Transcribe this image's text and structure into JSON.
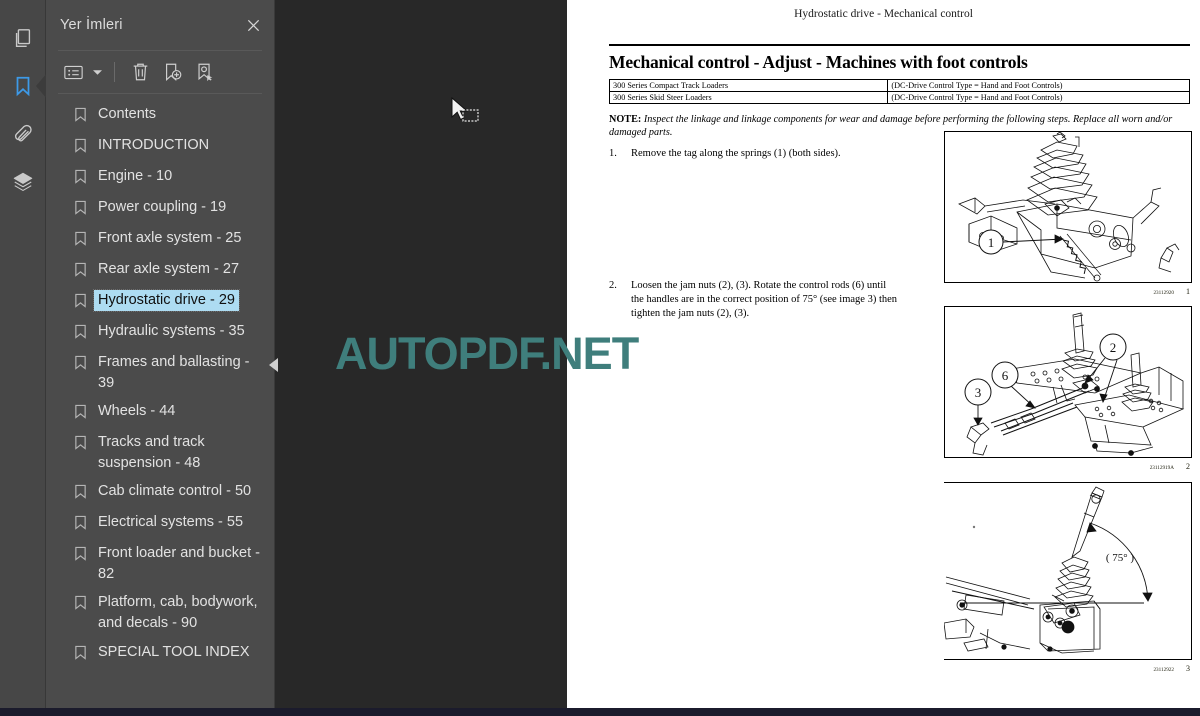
{
  "rail": {
    "items": [
      {
        "icon": "pages-thumbnail-icon",
        "name": "pages",
        "active": false
      },
      {
        "icon": "bookmark-icon",
        "name": "bookmarks",
        "active": true
      },
      {
        "icon": "paperclip-icon",
        "name": "attachments",
        "active": false
      },
      {
        "icon": "layers-icon",
        "name": "layers",
        "active": false
      }
    ]
  },
  "panel": {
    "title": "Yer İmleri",
    "close_label": "✕",
    "toolbar": {
      "options_label": "list-options-icon",
      "caret_label": "▾",
      "delete_label": "trash-icon",
      "add_label": "add-bookmark-icon",
      "edit_label": "edit-bookmark-icon"
    },
    "bookmarks": [
      {
        "label": "Contents",
        "selected": false
      },
      {
        "label": "INTRODUCTION",
        "selected": false
      },
      {
        "label": "Engine - 10",
        "selected": false
      },
      {
        "label": "Power coupling - 19",
        "selected": false
      },
      {
        "label": "Front axle system - 25",
        "selected": false
      },
      {
        "label": "Rear axle system - 27",
        "selected": false
      },
      {
        "label": "Hydrostatic drive - 29",
        "selected": true
      },
      {
        "label": "Hydraulic systems - 35",
        "selected": false
      },
      {
        "label": "Frames and ballasting - 39",
        "selected": false
      },
      {
        "label": "Wheels - 44",
        "selected": false
      },
      {
        "label": "Tracks and track suspension - 48",
        "selected": false
      },
      {
        "label": "Cab climate control - 50",
        "selected": false
      },
      {
        "label": "Electrical systems - 55",
        "selected": false
      },
      {
        "label": "Front loader and bucket - 82",
        "selected": false
      },
      {
        "label": "Platform, cab, bodywork, and decals - 90",
        "selected": false
      },
      {
        "label": "SPECIAL TOOL INDEX",
        "selected": false
      }
    ],
    "collapse_handle": "◀"
  },
  "document": {
    "running_head": "Hydrostatic drive - Mechanical control",
    "heading": "Mechanical control - Adjust - Machines with foot controls",
    "spec_table": {
      "rows": [
        [
          "300 Series Compact Track Loaders",
          "(DC-Drive Control Type = Hand and Foot Controls)"
        ],
        [
          "300 Series Skid Steer Loaders",
          "(DC-Drive Control Type = Hand and Foot Controls)"
        ]
      ]
    },
    "note_prefix": "NOTE:",
    "note_text": " Inspect the linkage and linkage components for wear and damage before performing the following steps. Replace all worn and/or damaged parts.",
    "steps": [
      {
        "number": "1.",
        "text": "Remove the tag along the springs (1) (both sides)."
      },
      {
        "number": "2.",
        "text": "Loosen the jam nuts (2), (3).  Rotate the control rods (6) until the handles are in the correct position of 75° (see image 3) then tighten the jam nuts (2), (3)."
      }
    ],
    "figures": [
      {
        "id": "23112920",
        "number": "1",
        "callouts": [
          "1"
        ]
      },
      {
        "id": "23112919A",
        "number": "2",
        "callouts": [
          "2",
          "3",
          "6"
        ]
      },
      {
        "id": "23112922",
        "number": "3",
        "annotation": "( 75° )"
      }
    ]
  },
  "watermark": {
    "text": "AUTOPDF.NET",
    "color": "#3f7e7c"
  },
  "cursor": {
    "type": "selection-marquee-cursor"
  }
}
